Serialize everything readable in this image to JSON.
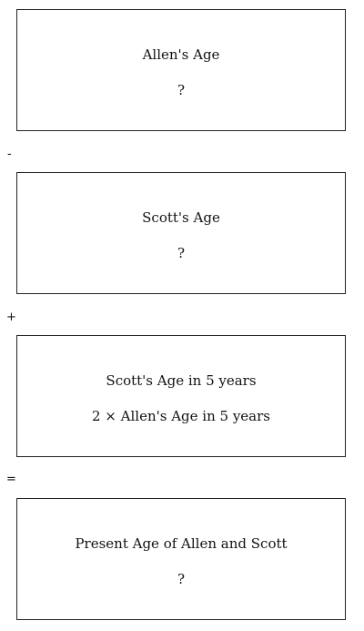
{
  "boxes": [
    {
      "title": "Allen's Age",
      "value": "?"
    },
    {
      "title": "Scott's Age",
      "value": "?"
    },
    {
      "title": "Scott's Age in 5 years",
      "value": "2 × Allen's Age in 5 years"
    },
    {
      "title": "Present Age of Allen and Scott",
      "value": "?"
    }
  ],
  "operators": [
    "-",
    "+",
    "="
  ]
}
